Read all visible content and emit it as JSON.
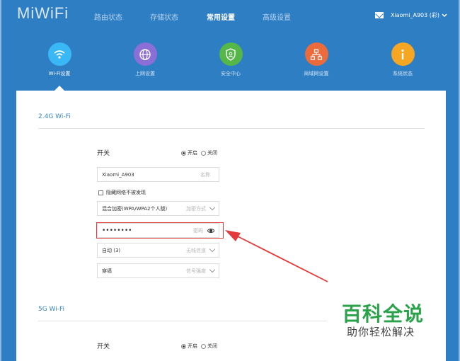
{
  "header": {
    "logo": "MiWiFi",
    "nav": [
      {
        "label": "路由状态"
      },
      {
        "label": "存储状态"
      },
      {
        "label": "常用设置"
      },
      {
        "label": "高级设置"
      }
    ],
    "user": "Xiaomi_A903 (彩)"
  },
  "subnav": [
    {
      "label": "Wi-Fi设置",
      "icon": "wifi-icon",
      "color": "#3ab7f5"
    },
    {
      "label": "上网设置",
      "icon": "globe-icon",
      "color": "#8b6fd6"
    },
    {
      "label": "安全中心",
      "icon": "shield-icon",
      "color": "#54b748"
    },
    {
      "label": "局域网设置",
      "icon": "network-icon",
      "color": "#ec6b3c"
    },
    {
      "label": "系统状态",
      "icon": "info-icon",
      "color": "#f5a623"
    }
  ],
  "wifi24": {
    "title": "2.4G Wi-Fi",
    "switch_label": "开关",
    "on_label": "开启",
    "off_label": "关闭",
    "ssid_value": "Xiaomi_A903",
    "ssid_hint": "名称",
    "hide_label": "隐藏网络不被发现",
    "encryption_value": "混合加密(WPA/WPA2个人版)",
    "encryption_hint": "加密方式",
    "password_value": "••••••••",
    "password_hint": "密码",
    "channel_value": "自动 (3)",
    "channel_hint": "无线信道",
    "strength_value": "穿墙",
    "strength_hint": "信号强度"
  },
  "wifi5": {
    "title": "5G Wi-Fi",
    "switch_label": "开关",
    "on_label": "开启",
    "off_label": "关闭"
  },
  "watermark": {
    "title": "百科全说",
    "subtitle": "助你轻松解决"
  },
  "colors": {
    "header_bg": "#2e7ec4",
    "accent": "#3a87c9",
    "highlight": "#e33b3b",
    "watermark": "#2aa24a"
  }
}
